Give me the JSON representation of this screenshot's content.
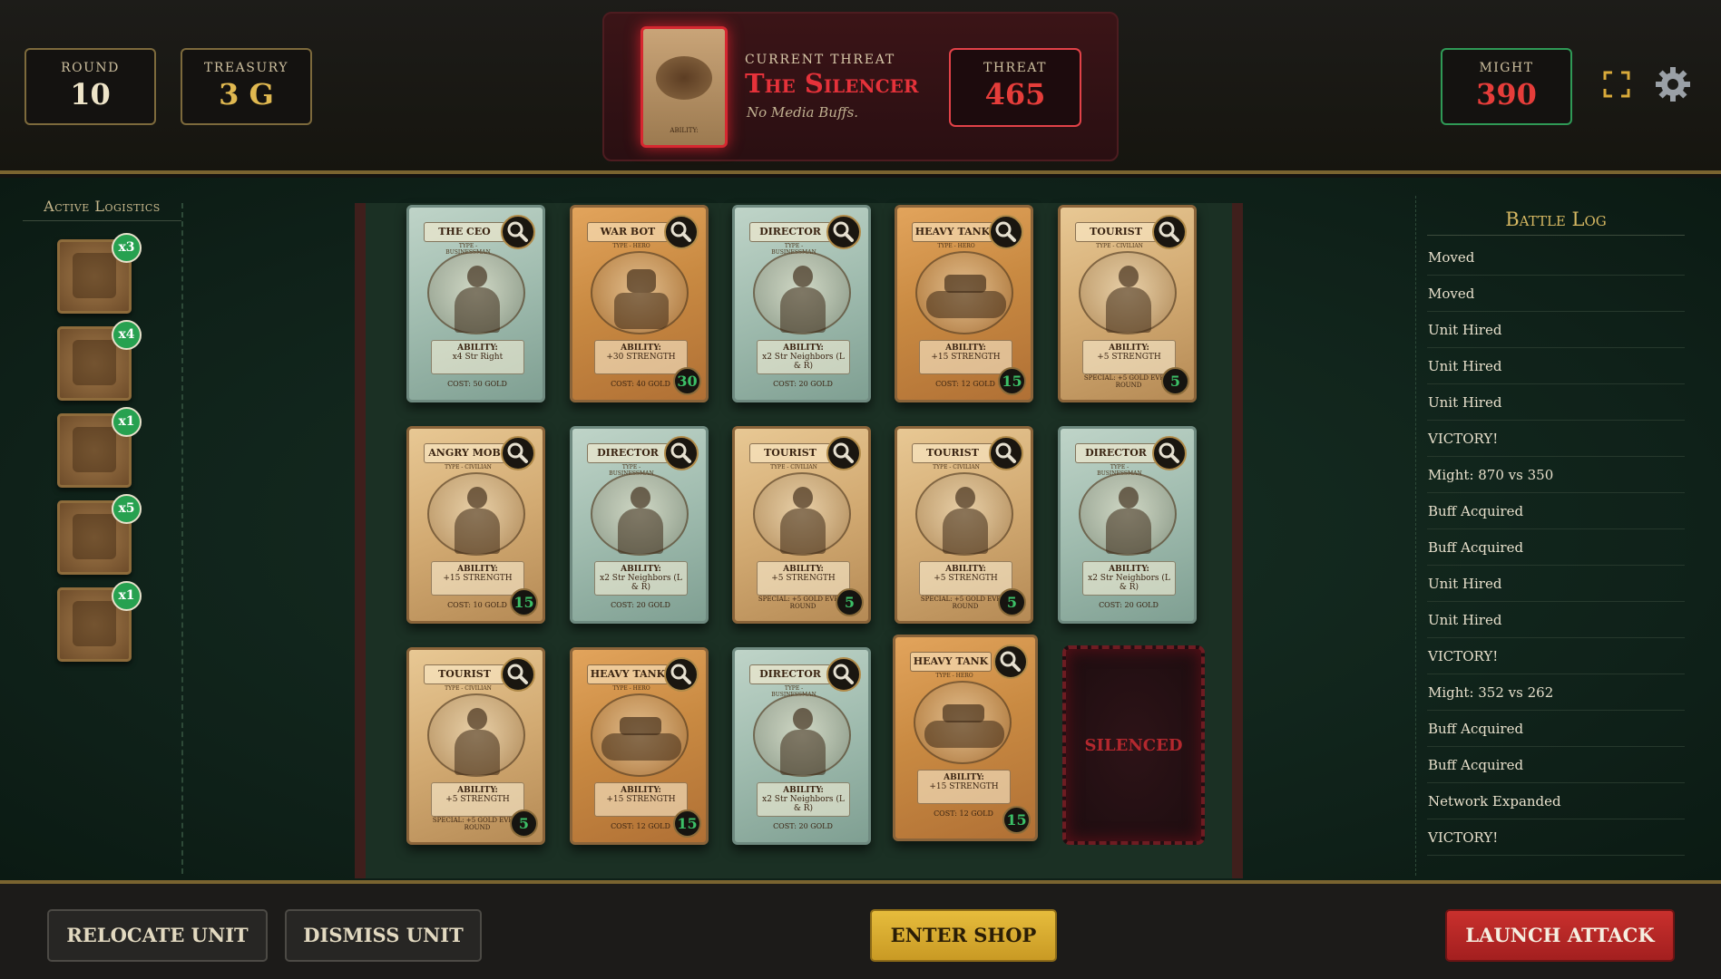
{
  "header": {
    "round_label": "Round",
    "round_value": "10",
    "treasury_label": "Treasury",
    "treasury_value": "3 G",
    "might_label": "Might",
    "might_value": "390",
    "fullscreen_icon": "fullscreen-icon",
    "settings_icon": "gear-icon"
  },
  "threat": {
    "label": "Current Threat",
    "name": "The Silencer",
    "description": "No Media Buffs.",
    "threat_label": "Threat",
    "threat_value": "465",
    "card_text": "ABILITY:"
  },
  "logistics": {
    "title": "Active Logistics",
    "items": [
      {
        "count": "x3"
      },
      {
        "count": "x4"
      },
      {
        "count": "x1"
      },
      {
        "count": "x5"
      },
      {
        "count": "x1"
      }
    ]
  },
  "board": {
    "cards": [
      {
        "name": "The CEO",
        "type": "Type - Businessman",
        "ability_title": "ABILITY:",
        "ability": "x4 Str Right",
        "special": "",
        "cost": "COST: 50 GOLD",
        "strength": ""
      },
      {
        "name": "War Bot",
        "type": "Type - Hero",
        "ability_title": "ABILITY:",
        "ability": "+30 STRENGTH",
        "special": "",
        "cost": "COST: 40 GOLD",
        "strength": "30"
      },
      {
        "name": "Director",
        "type": "Type - Businessman",
        "ability_title": "ABILITY:",
        "ability": "x2 Str Neighbors (L & R)",
        "special": "",
        "cost": "COST: 20 GOLD",
        "strength": ""
      },
      {
        "name": "Heavy Tank",
        "type": "Type - Hero",
        "ability_title": "ABILITY:",
        "ability": "+15 STRENGTH",
        "special": "",
        "cost": "COST: 12 GOLD",
        "strength": "15"
      },
      {
        "name": "Tourist",
        "type": "Type - Civilian",
        "ability_title": "ABILITY:",
        "ability": "+5 STRENGTH",
        "special": "SPECIAL: +5 GOLD EVERY ROUND",
        "cost": "",
        "strength": "5"
      },
      {
        "name": "Angry Mob",
        "type": "Type - Civilian",
        "ability_title": "ABILITY:",
        "ability": "+15 STRENGTH",
        "special": "",
        "cost": "COST: 10 GOLD",
        "strength": "15"
      },
      {
        "name": "Director",
        "type": "Type - Businessman",
        "ability_title": "ABILITY:",
        "ability": "x2 Str Neighbors (L & R)",
        "special": "",
        "cost": "COST: 20 GOLD",
        "strength": ""
      },
      {
        "name": "Tourist",
        "type": "Type - Civilian",
        "ability_title": "ABILITY:",
        "ability": "+5 STRENGTH",
        "special": "SPECIAL: +5 GOLD EVERY ROUND",
        "cost": "",
        "strength": "5"
      },
      {
        "name": "Tourist",
        "type": "Type - Civilian",
        "ability_title": "ABILITY:",
        "ability": "+5 STRENGTH",
        "special": "SPECIAL: +5 GOLD EVERY ROUND",
        "cost": "",
        "strength": "5"
      },
      {
        "name": "Director",
        "type": "Type - Businessman",
        "ability_title": "ABILITY:",
        "ability": "x2 Str Neighbors (L & R)",
        "special": "",
        "cost": "COST: 20 GOLD",
        "strength": ""
      },
      {
        "name": "Tourist",
        "type": "Type - Civilian",
        "ability_title": "ABILITY:",
        "ability": "+5 STRENGTH",
        "special": "SPECIAL: +5 GOLD EVERY ROUND",
        "cost": "",
        "strength": "5"
      },
      {
        "name": "Heavy Tank",
        "type": "Type - Hero",
        "ability_title": "ABILITY:",
        "ability": "+15 STRENGTH",
        "special": "",
        "cost": "COST: 12 GOLD",
        "strength": "15"
      },
      {
        "name": "Director",
        "type": "Type - Businessman",
        "ability_title": "ABILITY:",
        "ability": "x2 Str Neighbors (L & R)",
        "special": "",
        "cost": "COST: 20 GOLD",
        "strength": ""
      },
      {
        "name": "Heavy Tank",
        "type": "Type - Hero",
        "ability_title": "ABILITY:",
        "ability": "+15 STRENGTH",
        "special": "",
        "cost": "COST: 12 GOLD",
        "strength": "15"
      }
    ],
    "silenced_label": "SILENCED"
  },
  "battle_log": {
    "title": "Battle Log",
    "entries": [
      "Moved",
      "Moved",
      "Unit Hired",
      "Unit Hired",
      "Unit Hired",
      "VICTORY!",
      "Might: 870 vs 350",
      "Buff Acquired",
      "Buff Acquired",
      "Unit Hired",
      "Unit Hired",
      "VICTORY!",
      "Might: 352 vs 262",
      "Buff Acquired",
      "Buff Acquired",
      "Network Expanded",
      "VICTORY!"
    ]
  },
  "footer": {
    "relocate_label": "Relocate Unit",
    "dismiss_label": "Dismiss Unit",
    "shop_label": "Enter Shop",
    "attack_label": "Launch Attack"
  }
}
